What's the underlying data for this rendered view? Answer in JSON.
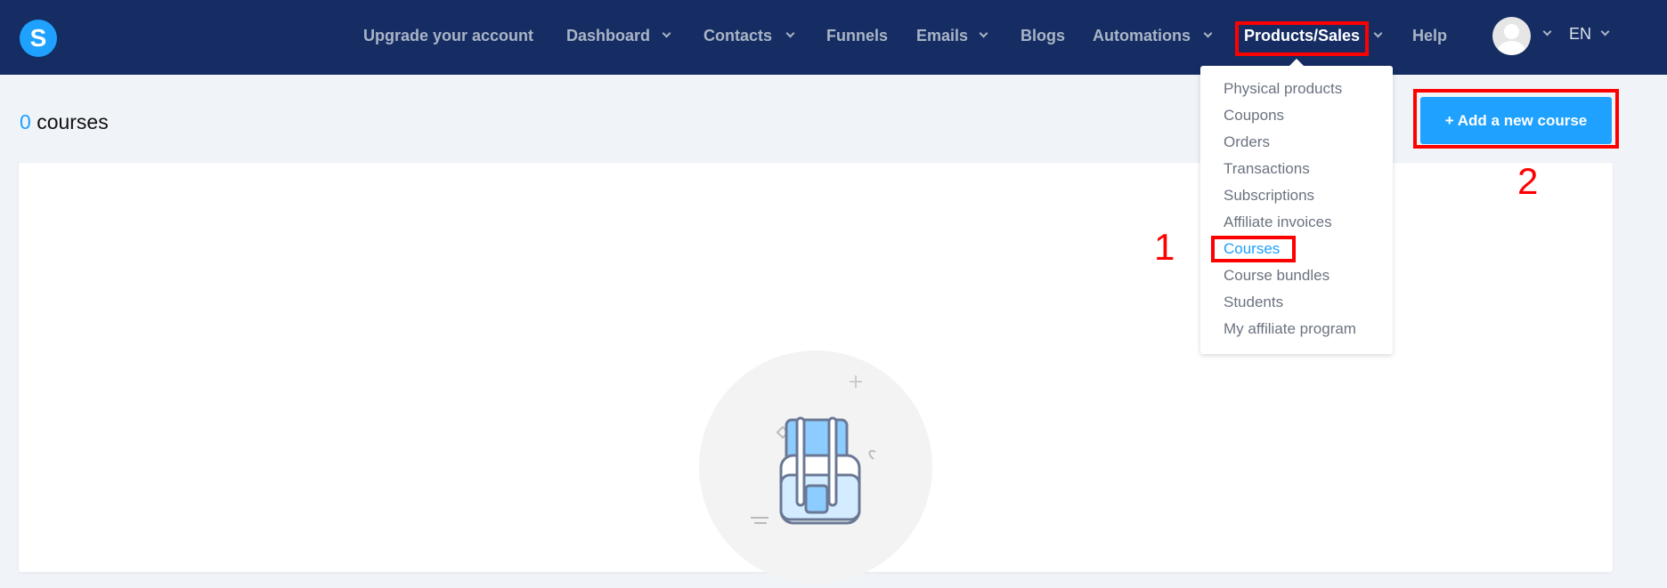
{
  "logo": {
    "letter": "S"
  },
  "nav": {
    "items": [
      {
        "label": "Upgrade your account",
        "dropdown": false
      },
      {
        "label": "Dashboard",
        "dropdown": true
      },
      {
        "label": "Contacts",
        "dropdown": true
      },
      {
        "label": "Funnels",
        "dropdown": false
      },
      {
        "label": "Emails",
        "dropdown": true
      },
      {
        "label": "Blogs",
        "dropdown": false
      },
      {
        "label": "Automations",
        "dropdown": true
      },
      {
        "label": "Products/Sales",
        "dropdown": true,
        "active": true
      },
      {
        "label": "Help",
        "dropdown": false
      }
    ],
    "language": "EN"
  },
  "dropdown": {
    "items": [
      "Physical products",
      "Coupons",
      "Orders",
      "Transactions",
      "Subscriptions",
      "Affiliate invoices",
      "Courses",
      "Course bundles",
      "Students",
      "My affiliate program"
    ],
    "selected": "Courses"
  },
  "page": {
    "count": "0",
    "count_label": "courses",
    "add_button": "+ Add a new course"
  },
  "annotations": {
    "step1": "1",
    "step2": "2"
  },
  "colors": {
    "header": "#152d63",
    "accent": "#1ea1ff",
    "annotation": "#ff0000"
  }
}
